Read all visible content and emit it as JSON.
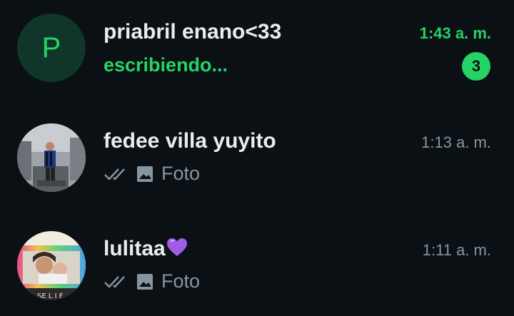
{
  "chats": [
    {
      "avatar_letter": "P",
      "name": "priabril enano<33",
      "time": "1:43 a. m.",
      "status": "escribiendo...",
      "unread_count": "3"
    },
    {
      "avatar_icon": "profile-photo",
      "name": "fedee villa yuyito",
      "time": "1:13 a. m.",
      "preview_icons": [
        "double-check-icon",
        "photo-icon"
      ],
      "preview": "Foto"
    },
    {
      "avatar_icon": "profile-photo",
      "name": "lulitaa",
      "name_emoji_icon": "purple-heart-icon",
      "time": "1:11 a. m.",
      "preview_icons": [
        "double-check-icon",
        "photo-icon"
      ],
      "preview": "Foto"
    }
  ],
  "colors": {
    "background": "#0b1014",
    "accent": "#25d366",
    "primary_text": "#e9edef",
    "secondary_text": "#8696a0",
    "heart": "#a05ce6"
  }
}
